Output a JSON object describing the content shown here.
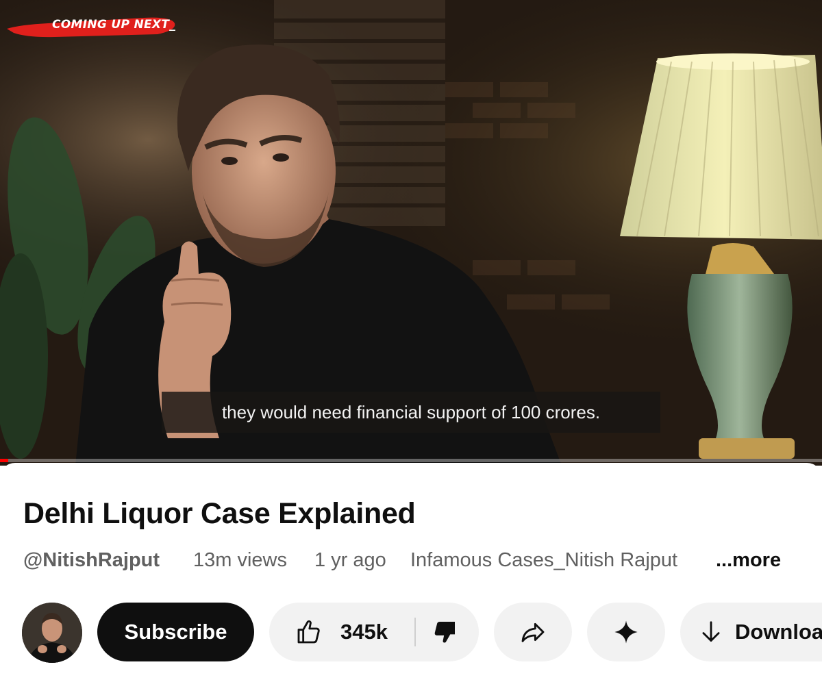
{
  "player": {
    "coming_up_label": "Coming Up Next_",
    "caption": "they would need financial support of 100 crores.",
    "progress_fraction": 0.01,
    "accent_color": "#ff0000"
  },
  "video": {
    "title": "Delhi Liquor Case Explained",
    "channel_handle": "@NitishRajput",
    "views": "13m views",
    "age": "1 yr ago",
    "playlist": "Infamous Cases_Nitish Rajput",
    "more_label": "...more"
  },
  "actions": {
    "subscribe_label": "Subscribe",
    "like_count": "345k",
    "download_label": "Download",
    "icons": [
      "avatar",
      "thumbs-up-icon",
      "thumbs-down-icon",
      "share-icon",
      "sparkle-icon",
      "download-icon"
    ]
  }
}
